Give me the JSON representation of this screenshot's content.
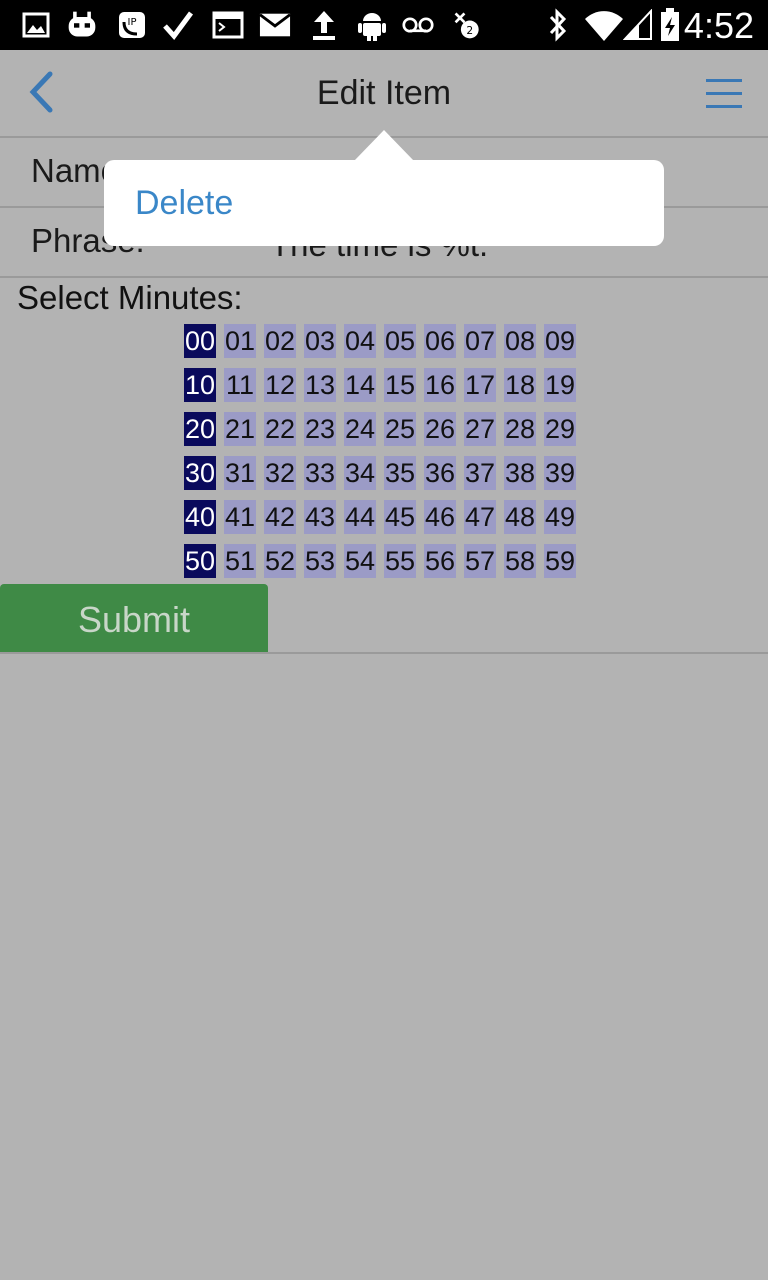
{
  "status_bar": {
    "time": "4:52",
    "icons": [
      "gallery-icon",
      "cyanogen-icon",
      "voip-call-icon",
      "check-icon",
      "terminal-icon",
      "mail-icon",
      "upload-icon",
      "android-icon",
      "voicemail-icon",
      "notification-badge-icon",
      "bluetooth-icon",
      "wifi-icon",
      "cell-signal-icon",
      "battery-charging-icon"
    ]
  },
  "header": {
    "title": "Edit Item"
  },
  "form": {
    "name_label": "Name:",
    "phrase_label": "Phrase:",
    "phrase_value": "The time is %t.",
    "select_label": "Select Minutes:",
    "minutes": [
      "00",
      "01",
      "02",
      "03",
      "04",
      "05",
      "06",
      "07",
      "08",
      "09",
      "10",
      "11",
      "12",
      "13",
      "14",
      "15",
      "16",
      "17",
      "18",
      "19",
      "20",
      "21",
      "22",
      "23",
      "24",
      "25",
      "26",
      "27",
      "28",
      "29",
      "30",
      "31",
      "32",
      "33",
      "34",
      "35",
      "36",
      "37",
      "38",
      "39",
      "40",
      "41",
      "42",
      "43",
      "44",
      "45",
      "46",
      "47",
      "48",
      "49",
      "50",
      "51",
      "52",
      "53",
      "54",
      "55",
      "56",
      "57",
      "58",
      "59"
    ],
    "selected_minutes": [
      "00",
      "10",
      "20",
      "30",
      "40",
      "50"
    ],
    "submit_label": "Submit"
  },
  "popover": {
    "delete_label": "Delete"
  },
  "colors": {
    "accent": "#3a87c8",
    "selected_cell": "#0a0a5c",
    "cell": "#9b9bc6",
    "submit": "#3f8a46"
  }
}
